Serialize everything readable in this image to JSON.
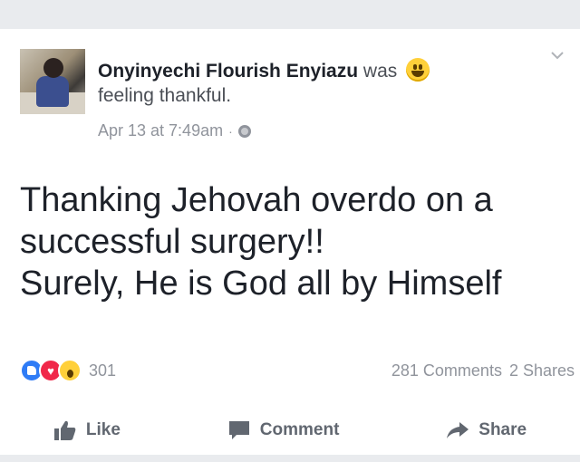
{
  "post": {
    "author": "Onyinyechi Flourish Enyiazu",
    "activity_verb": "was",
    "feeling": "feeling thankful.",
    "timestamp": "Apr 13 at 7:49am",
    "separator": "·",
    "privacy_icon": "globe-icon",
    "body_lines": [
      "Thanking Jehovah overdo on a",
      "successful surgery!!",
      "Surely, He is God all by Himself"
    ]
  },
  "reactions": {
    "icons": [
      "like-reaction-icon",
      "love-reaction-icon",
      "wow-reaction-icon"
    ],
    "count": "301",
    "comments": "281 Comments",
    "shares": "2 Shares"
  },
  "actions": {
    "like": "Like",
    "comment": "Comment",
    "share": "Share"
  },
  "colors": {
    "background": "#e9ebee",
    "card": "#ffffff",
    "text_primary": "#1d2129",
    "text_secondary": "#90949c",
    "like_blue": "#2f7cf6",
    "love_red": "#f0284a",
    "wow_yellow": "#ffd03a"
  }
}
